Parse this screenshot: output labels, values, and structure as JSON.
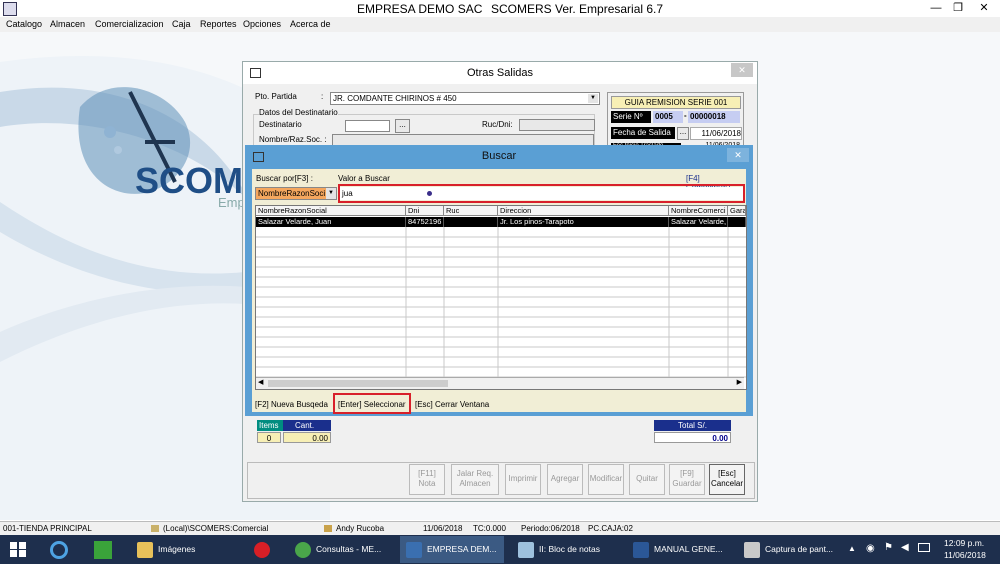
{
  "app": {
    "title": "EMPRESA DEMO SAC",
    "version": "SCOMERS Ver. Empresarial  6.7",
    "menu": [
      "Catalogo",
      "Almacen",
      "Comercializacion",
      "Caja",
      "Reportes",
      "Opciones",
      "Acerca de"
    ],
    "window_controls": [
      "—",
      "❐",
      "✕"
    ]
  },
  "logo": {
    "text": "SCOMER",
    "subtext": "Empr"
  },
  "otras_salidas": {
    "title": "Otras Salidas",
    "pto_partida_label": "Pto. Partida",
    "pto_partida_colon": ":",
    "pto_partida_value": "JR. COMDANTE CHIRINOS # 450",
    "datos_destinatario": "Datos del Destinatario",
    "destinatario_label": "Destinatario",
    "ruc_dni_label": "Ruc/Dni:",
    "nombre_label": "Nombre/Raz.Soc. :",
    "browse_btn": "...",
    "guia_title": "GUIA REMISION SERIE 001",
    "serie_label": "Serie Nº",
    "serie_value": "0005",
    "serie_sep": "-",
    "numero_value": "00000018",
    "fecha_salida_label": "Fecha de Salida",
    "fecha_salida_btn": "...",
    "fecha_salida_value": "11/06/2018",
    "fecha_traslado_label": "Fec.Inicio Traslado",
    "fecha_traslado_value": "11/06/2018",
    "items_label": "Items",
    "items_value": "0",
    "cant_label": "Cant.",
    "cant_value": "0.00",
    "total_label": "Total S/.",
    "total_value": "0.00",
    "buttons": [
      {
        "hotkey": "[F11]",
        "label": "Nota"
      },
      {
        "hotkey": "Jalar Req.",
        "label": "Almacen"
      },
      {
        "hotkey": "",
        "label": "Imprimir"
      },
      {
        "hotkey": "",
        "label": "Agregar"
      },
      {
        "hotkey": "",
        "label": "Modificar"
      },
      {
        "hotkey": "",
        "label": "Quitar"
      },
      {
        "hotkey": "[F9]",
        "label": "Guardar"
      },
      {
        "hotkey": "[Esc]",
        "label": "Cancelar"
      }
    ]
  },
  "buscar": {
    "title": "Buscar",
    "buscar_por_label": "Buscar por[F3] :",
    "buscar_por_value": "NombreRazonSoci",
    "valor_label": "Valor a Buscar",
    "valor_value": "jua",
    "comodin": "[F4] Comodin(%)",
    "columns": [
      "NombreRazonSocial",
      "Dni",
      "Ruc",
      "Direccion",
      "NombreComerci",
      "Gara"
    ],
    "rows": [
      [
        "Salazar Velarde, Juan",
        "84752196",
        "",
        "Jr. Los pinos-Tarapoto",
        "Salazar Velarde,",
        ""
      ]
    ],
    "footer": {
      "nueva": "[F2] Nueva Busqeda",
      "seleccionar": "[Enter] Seleccionar",
      "cerrar": "[Esc] Cerrar Ventana"
    }
  },
  "status": {
    "tienda": "001-TIENDA PRINCIPAL",
    "db": "(Local)\\SCOMERS:Comercial",
    "user": "Andy Rucoba",
    "fecha": "11/06/2018",
    "tc": "TC:0.000",
    "periodo": "Periodo:06/2018",
    "caja": "PC.CAJA:02"
  },
  "taskbar": {
    "items": [
      {
        "label": "Imágenes",
        "color": "#e8c15a"
      },
      {
        "label": "",
        "color": "#d81f26"
      },
      {
        "label": "Consultas - ME...",
        "color": "#4aa54a"
      },
      {
        "label": "EMPRESA DEM...",
        "color": "#3a6fb0"
      },
      {
        "label": "II: Bloc de notas",
        "color": "#9ec1de"
      },
      {
        "label": "MANUAL GENE...",
        "color": "#2b5797"
      },
      {
        "label": "Captura de pant...",
        "color": "#c9c9c9"
      }
    ],
    "time": "12:09 p.m.",
    "date": "11/06/2018"
  }
}
